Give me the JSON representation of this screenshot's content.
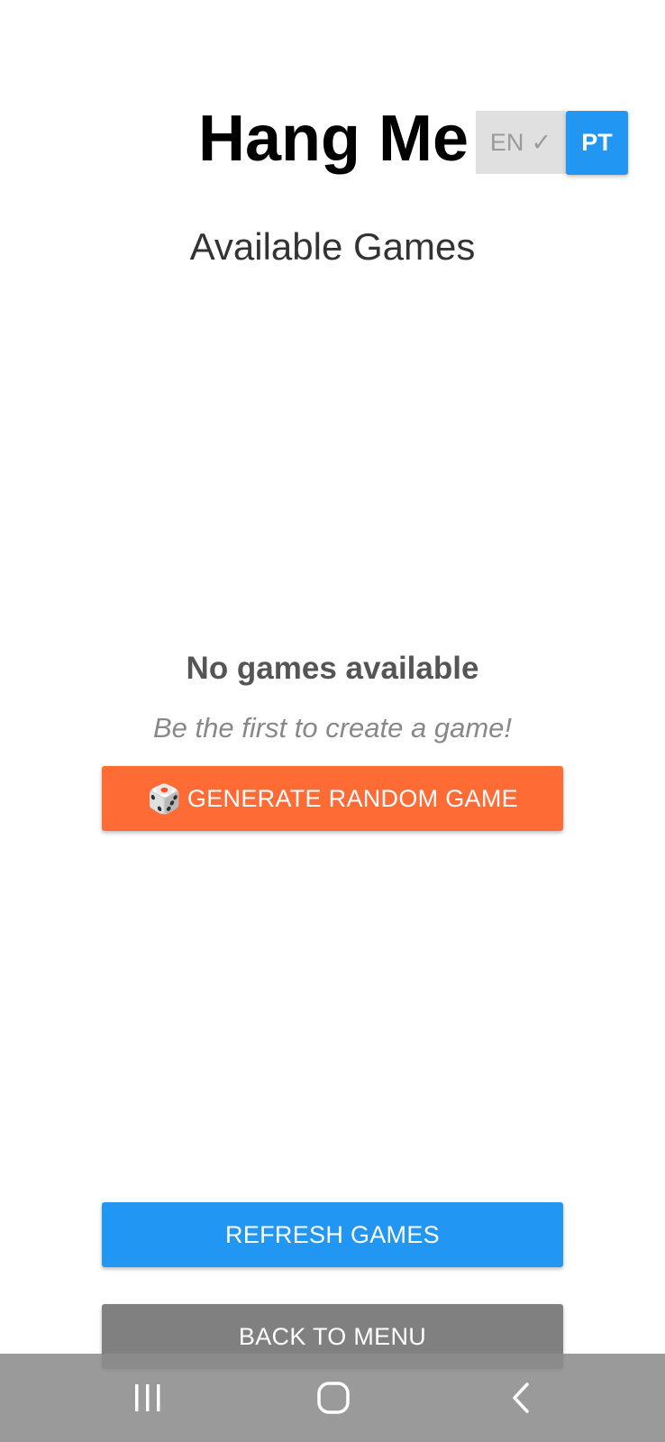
{
  "header": {
    "title": "Hang Me",
    "lang_en_label": "EN",
    "lang_en_check": "✓",
    "lang_pt_label": "PT"
  },
  "main": {
    "subtitle": "Available Games",
    "empty_title": "No games available",
    "empty_subtitle": "Be the first to create a game!",
    "random_icon": "🎲",
    "random_label": "GENERATE RANDOM GAME"
  },
  "footer": {
    "refresh_label": "REFRESH GAMES",
    "back_label": "BACK TO MENU"
  },
  "navbar": {
    "icons": [
      "recent-apps-icon",
      "home-icon",
      "back-icon"
    ]
  },
  "colors": {
    "primary": "#2196f3",
    "accent": "#ff6b35",
    "secondary": "#808080"
  }
}
